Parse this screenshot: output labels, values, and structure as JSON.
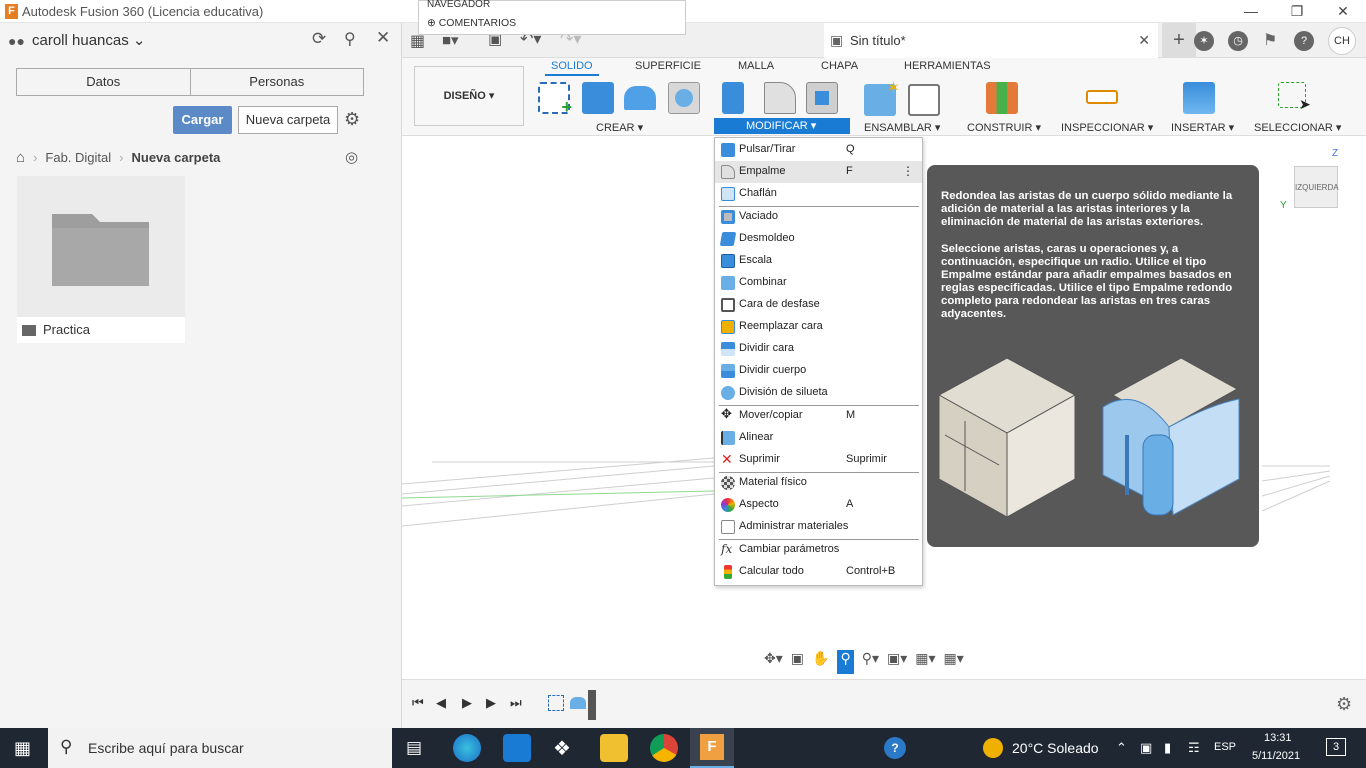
{
  "window": {
    "title": "Autodesk Fusion 360 (Licencia educativa)",
    "above_menu": [
      "NAVEGADOR",
      "COMENTARIOS"
    ]
  },
  "left_panel": {
    "user": "caroll huancas",
    "tabs": [
      "Datos",
      "Personas"
    ],
    "upload_button": "Cargar",
    "new_folder_button": "Nueva carpeta",
    "breadcrumb": [
      "Fab. Digital",
      "Nueva carpeta"
    ],
    "folder_name": "Practica"
  },
  "document": {
    "tab_title": "Sin título*",
    "avatar_initials": "CH"
  },
  "ribbon": {
    "tabs": [
      "SOLIDO",
      "SUPERFICIE",
      "MALLA",
      "CHAPA",
      "HERRAMIENTAS"
    ],
    "active_tab": "SOLIDO",
    "workspace": "DISEÑO",
    "groups": [
      "CREAR",
      "MODIFICAR",
      "ENSAMBLAR",
      "CONSTRUIR",
      "INSPECCIONAR",
      "INSERTAR",
      "SELECCIONAR"
    ]
  },
  "modify_menu": {
    "items": [
      {
        "label": "Pulsar/Tirar",
        "shortcut": "Q",
        "icon": "press-pull-icon"
      },
      {
        "label": "Empalme",
        "shortcut": "F",
        "icon": "fillet-icon",
        "highlighted": true
      },
      {
        "label": "Chaflán",
        "shortcut": "",
        "icon": "chamfer-icon"
      },
      {
        "label": "Vaciado",
        "shortcut": "",
        "icon": "shell-icon"
      },
      {
        "label": "Desmoldeo",
        "shortcut": "",
        "icon": "draft-icon"
      },
      {
        "label": "Escala",
        "shortcut": "",
        "icon": "scale-icon"
      },
      {
        "label": "Combinar",
        "shortcut": "",
        "icon": "combine-icon"
      },
      {
        "label": "Cara de desfase",
        "shortcut": "",
        "icon": "offset-face-icon"
      },
      {
        "label": "Reemplazar cara",
        "shortcut": "",
        "icon": "replace-face-icon"
      },
      {
        "label": "Dividir cara",
        "shortcut": "",
        "icon": "split-face-icon"
      },
      {
        "label": "Dividir cuerpo",
        "shortcut": "",
        "icon": "split-body-icon"
      },
      {
        "label": "División de silueta",
        "shortcut": "",
        "icon": "silhouette-split-icon"
      },
      {
        "label": "Mover/copiar",
        "shortcut": "M",
        "icon": "move-icon"
      },
      {
        "label": "Alinear",
        "shortcut": "",
        "icon": "align-icon"
      },
      {
        "label": "Suprimir",
        "shortcut": "Suprimir",
        "icon": "delete-icon"
      },
      {
        "label": "Material físico",
        "shortcut": "",
        "icon": "physical-material-icon"
      },
      {
        "label": "Aspecto",
        "shortcut": "A",
        "icon": "appearance-icon"
      },
      {
        "label": "Administrar materiales",
        "shortcut": "",
        "icon": "manage-materials-icon"
      },
      {
        "label": "Cambiar parámetros",
        "shortcut": "",
        "icon": "parameters-icon"
      },
      {
        "label": "Calcular todo",
        "shortcut": "Control+B",
        "icon": "compute-all-icon"
      }
    ]
  },
  "tooltip": {
    "paragraph1": "Redondea las aristas de un cuerpo sólido mediante la adición de material a las aristas interiores y la eliminación de material de las aristas exteriores.",
    "paragraph2": "Seleccione aristas, caras u operaciones y, a continuación, especifique un radio. Utilice el tipo Empalme estándar para añadir empalmes basados en reglas especificadas. Utilice el tipo Empalme redondo completo para redondear las aristas en tres caras adyacentes."
  },
  "viewcube": {
    "face": "IZQUIERDA",
    "axis_z": "Z",
    "axis_y": "Y"
  },
  "taskbar": {
    "search_placeholder": "Escribe aquí para buscar",
    "weather": "20°C  Soleado",
    "language": "ESP",
    "time": "13:31",
    "date": "5/11/2021",
    "notifications": "3"
  },
  "colors": {
    "accent": "#1a7bd4",
    "upload_button": "#5b8ac6",
    "tooltip_bg": "#585858",
    "taskbar": "#1f2733"
  }
}
